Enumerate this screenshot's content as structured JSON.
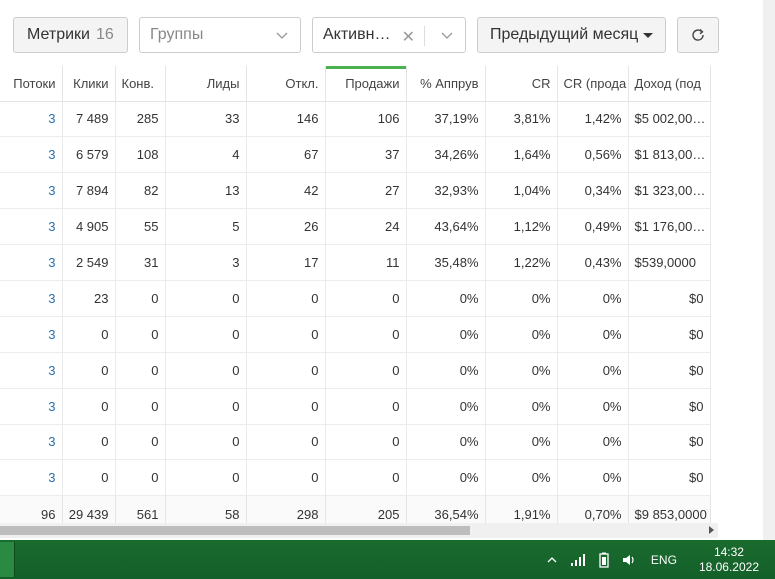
{
  "toolbar": {
    "metrics_label": "Метрики",
    "metrics_count": "16",
    "groups_placeholder": "Группы",
    "active_value": "Активн…",
    "clear_symbol": "✕",
    "period_label": "Предыдущий месяц"
  },
  "table": {
    "columns": [
      "Потоки",
      "Клики",
      "Конв.",
      "Лиды",
      "Откл.",
      "Продажи",
      "% Аппрув",
      "CR",
      "CR (прода",
      "Доход (под"
    ],
    "sorted_column": "Продажи",
    "rows": [
      [
        "3",
        "7 489",
        "285",
        "33",
        "146",
        "106",
        "37,19%",
        "3,81%",
        "1,42%",
        "$5 002,00…"
      ],
      [
        "3",
        "6 579",
        "108",
        "4",
        "67",
        "37",
        "34,26%",
        "1,64%",
        "0,56%",
        "$1 813,00…"
      ],
      [
        "3",
        "7 894",
        "82",
        "13",
        "42",
        "27",
        "32,93%",
        "1,04%",
        "0,34%",
        "$1 323,00…"
      ],
      [
        "3",
        "4 905",
        "55",
        "5",
        "26",
        "24",
        "43,64%",
        "1,12%",
        "0,49%",
        "$1 176,00…"
      ],
      [
        "3",
        "2 549",
        "31",
        "3",
        "17",
        "11",
        "35,48%",
        "1,22%",
        "0,43%",
        "$539,0000"
      ],
      [
        "3",
        "23",
        "0",
        "0",
        "0",
        "0",
        "0%",
        "0%",
        "0%",
        "$0"
      ],
      [
        "3",
        "0",
        "0",
        "0",
        "0",
        "0",
        "0%",
        "0%",
        "0%",
        "$0"
      ],
      [
        "3",
        "0",
        "0",
        "0",
        "0",
        "0",
        "0%",
        "0%",
        "0%",
        "$0"
      ],
      [
        "3",
        "0",
        "0",
        "0",
        "0",
        "0",
        "0%",
        "0%",
        "0%",
        "$0"
      ],
      [
        "3",
        "0",
        "0",
        "0",
        "0",
        "0",
        "0%",
        "0%",
        "0%",
        "$0"
      ],
      [
        "3",
        "0",
        "0",
        "0",
        "0",
        "0",
        "0%",
        "0%",
        "0%",
        "$0"
      ]
    ],
    "totals": [
      "96",
      "29 439",
      "561",
      "58",
      "298",
      "205",
      "36,54%",
      "1,91%",
      "0,70%",
      "$9 853,0000"
    ]
  },
  "taskbar": {
    "language": "ENG",
    "time": "14:32",
    "date": "18.06.2022"
  }
}
